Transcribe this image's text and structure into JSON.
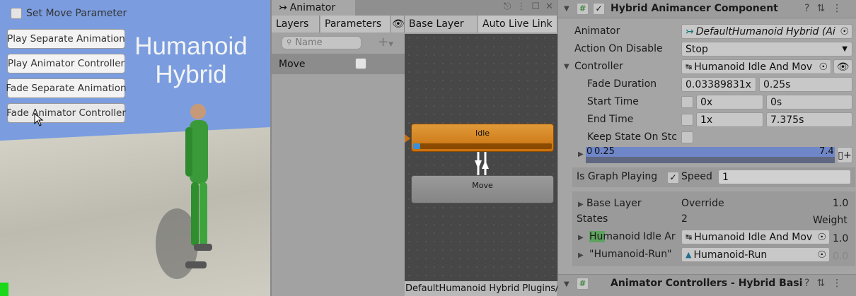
{
  "game": {
    "toggle_label": "Set Move Parameter",
    "buttons": [
      "Play Separate Animation",
      "Play Animator Controller",
      "Fade Separate Animation",
      "Fade Animator Controller"
    ],
    "title_line1": "Humanoid",
    "title_line2": "Hybrid"
  },
  "animator": {
    "window_title": "Animator",
    "tabs": [
      "Layers",
      "Parameters"
    ],
    "breadcrumb": "Base Layer",
    "auto_live_link": "Auto Live Link",
    "search_placeholder": "Name",
    "parameters": [
      {
        "name": "Move",
        "value": false
      }
    ],
    "states": [
      {
        "name": "Idle",
        "progress": 0.05
      },
      {
        "name": "Move"
      }
    ],
    "footer_path": "DefaultHumanoid Hybrid Plugins/"
  },
  "inspector": {
    "component_title": "Hybrid Animancer Component",
    "animator_label": "Animator",
    "animator_value": "DefaultHumanoid Hybrid (Ai",
    "action_label": "Action On Disable",
    "action_value": "Stop",
    "controller_label": "Controller",
    "controller_value": "Humanoid Idle And Mov",
    "fade_label": "Fade Duration",
    "fade_norm": "0.03389831x",
    "fade_sec": "0.25s",
    "start_label": "Start Time",
    "start_norm": "0x",
    "start_sec": "0s",
    "end_label": "End Time",
    "end_norm": "1x",
    "end_sec": "7.375s",
    "keep_label": "Keep State On Stc",
    "timeline_start": "0",
    "timeline_fade": "0.25",
    "timeline_end": "7.4",
    "graph_playing_label": "Is Graph Playing",
    "graph_playing": true,
    "speed_label": "Speed",
    "speed_value": "1",
    "layer_name": "Base Layer",
    "layer_mode": "Override",
    "layer_weight": "1.0",
    "states_label": "States",
    "states_count": "2",
    "weight_label": "Weight",
    "state_rows": [
      {
        "name": "Humanoid Idle Ar",
        "asset": "Humanoid Idle And Mov",
        "weight": "1.0"
      },
      {
        "name": "\"Humanoid-Run\"",
        "asset": "Humanoid-Run",
        "weight": "0.0"
      }
    ],
    "next_component_title": "Animator Controllers - Hybrid Basi"
  }
}
